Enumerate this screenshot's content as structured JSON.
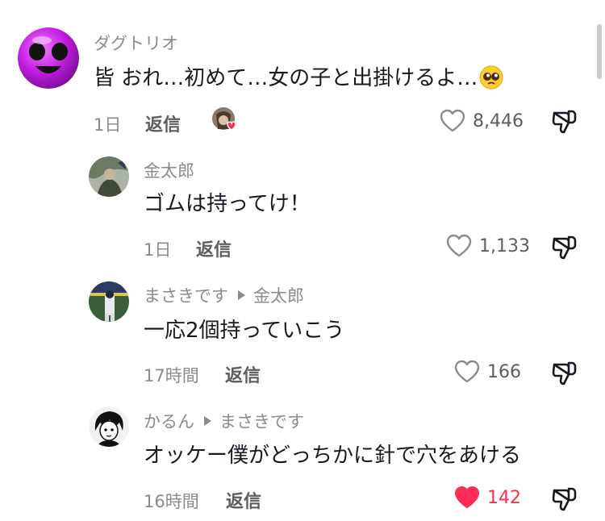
{
  "comments": [
    {
      "username": "ダグトリオ",
      "text": "皆 おれ…初めて…女の子と出掛けるよ…",
      "emoji": "pleading-face",
      "time": "1日",
      "reply_label": "返信",
      "likes": "8,446",
      "liked": false,
      "creator_liked": true
    },
    {
      "username": "金太郎",
      "text": "ゴムは持ってけ！",
      "time": "1日",
      "reply_label": "返信",
      "likes": "1,133",
      "liked": false
    },
    {
      "username": "まさきです",
      "reply_to": "金太郎",
      "text": "一応2個持っていこう",
      "time": "17時間",
      "reply_label": "返信",
      "likes": "166",
      "liked": false
    },
    {
      "username": "かるん",
      "reply_to": "まさきです",
      "text": "オッケー僕がどっちかに針で穴をあける",
      "time": "16時間",
      "reply_label": "返信",
      "likes": "142",
      "liked": true
    }
  ],
  "colors": {
    "like_active": "#fe2c55",
    "secondary_text": "#8a8b91",
    "avatar_purple": "#c21ee0"
  }
}
